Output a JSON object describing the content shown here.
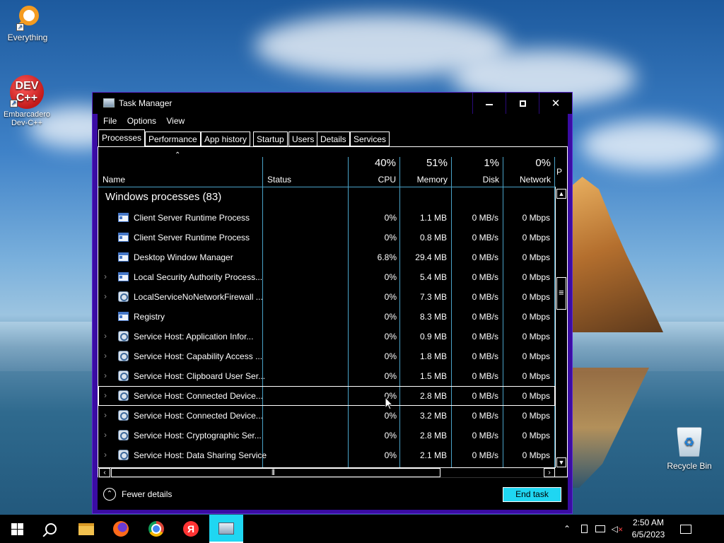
{
  "desktop": {
    "icons": [
      {
        "label": "Everything"
      },
      {
        "label": "Embarcadero Dev-C++",
        "glyph_text": "DEV C++"
      },
      {
        "label": "Recycle Bin"
      }
    ]
  },
  "window": {
    "title": "Task Manager",
    "controls": {
      "minimize": "minimize",
      "maximize": "maximize",
      "close": "✕"
    },
    "menu": [
      "File",
      "Options",
      "View"
    ],
    "tabs": [
      "Processes",
      "Performance",
      "App history",
      "Startup",
      "Users",
      "Details",
      "Services"
    ],
    "active_tab": "Processes",
    "columns": {
      "name": "Name",
      "status": "Status",
      "cpu": {
        "label": "CPU",
        "pct": "40%"
      },
      "memory": {
        "label": "Memory",
        "pct": "51%"
      },
      "disk": {
        "label": "Disk",
        "pct": "1%"
      },
      "network": {
        "label": "Network",
        "pct": "0%"
      },
      "power": "P"
    },
    "group_title": "Windows processes (83)",
    "processes": [
      {
        "name": "Client Server Runtime Process",
        "icon": "window-icon",
        "expandable": false,
        "cpu": "0%",
        "memory": "1.1 MB",
        "disk": "0 MB/s",
        "network": "0 Mbps"
      },
      {
        "name": "Client Server Runtime Process",
        "icon": "window-icon",
        "expandable": false,
        "cpu": "0%",
        "memory": "0.8 MB",
        "disk": "0 MB/s",
        "network": "0 Mbps"
      },
      {
        "name": "Desktop Window Manager",
        "icon": "window-icon",
        "expandable": false,
        "cpu": "6.8%",
        "memory": "29.4 MB",
        "disk": "0 MB/s",
        "network": "0 Mbps"
      },
      {
        "name": "Local Security Authority Process...",
        "icon": "window-icon",
        "expandable": true,
        "cpu": "0%",
        "memory": "5.4 MB",
        "disk": "0 MB/s",
        "network": "0 Mbps"
      },
      {
        "name": "LocalServiceNoNetworkFirewall ...",
        "icon": "gear-icon",
        "expandable": true,
        "cpu": "0%",
        "memory": "7.3 MB",
        "disk": "0 MB/s",
        "network": "0 Mbps"
      },
      {
        "name": "Registry",
        "icon": "window-icon",
        "expandable": false,
        "cpu": "0%",
        "memory": "8.3 MB",
        "disk": "0 MB/s",
        "network": "0 Mbps"
      },
      {
        "name": "Service Host: Application Infor...",
        "icon": "gear-icon",
        "expandable": true,
        "cpu": "0%",
        "memory": "0.9 MB",
        "disk": "0 MB/s",
        "network": "0 Mbps"
      },
      {
        "name": "Service Host: Capability Access ...",
        "icon": "gear-icon",
        "expandable": true,
        "cpu": "0%",
        "memory": "1.8 MB",
        "disk": "0 MB/s",
        "network": "0 Mbps"
      },
      {
        "name": "Service Host: Clipboard User Ser...",
        "icon": "gear-icon",
        "expandable": true,
        "cpu": "0%",
        "memory": "1.5 MB",
        "disk": "0 MB/s",
        "network": "0 Mbps"
      },
      {
        "name": "Service Host: Connected Device...",
        "icon": "gear-icon",
        "expandable": true,
        "cpu": "0%",
        "memory": "2.8 MB",
        "disk": "0 MB/s",
        "network": "0 Mbps",
        "selected": true
      },
      {
        "name": "Service Host: Connected Device...",
        "icon": "gear-icon",
        "expandable": true,
        "cpu": "0%",
        "memory": "3.2 MB",
        "disk": "0 MB/s",
        "network": "0 Mbps"
      },
      {
        "name": "Service Host: Cryptographic Ser...",
        "icon": "gear-icon",
        "expandable": true,
        "cpu": "0%",
        "memory": "2.8 MB",
        "disk": "0 MB/s",
        "network": "0 Mbps"
      },
      {
        "name": "Service Host: Data Sharing Service",
        "icon": "gear-icon",
        "expandable": true,
        "cpu": "0%",
        "memory": "2.1 MB",
        "disk": "0 MB/s",
        "network": "0 Mbps"
      }
    ],
    "footer": {
      "fewer_details": "Fewer details",
      "end_task": "End task"
    },
    "colors": {
      "frame": "#3a0ca3",
      "accent": "#1fd6f2",
      "separator": "#4aa3c8"
    }
  },
  "taskbar": {
    "pinned": [
      "start-icon",
      "search-icon",
      "file-explorer-icon",
      "firefox-icon",
      "chrome-icon",
      "yandex-icon",
      "task-manager-icon"
    ],
    "yandex_glyph": "Я",
    "clock": {
      "time": "2:50 AM",
      "date": "6/5/2023"
    }
  }
}
